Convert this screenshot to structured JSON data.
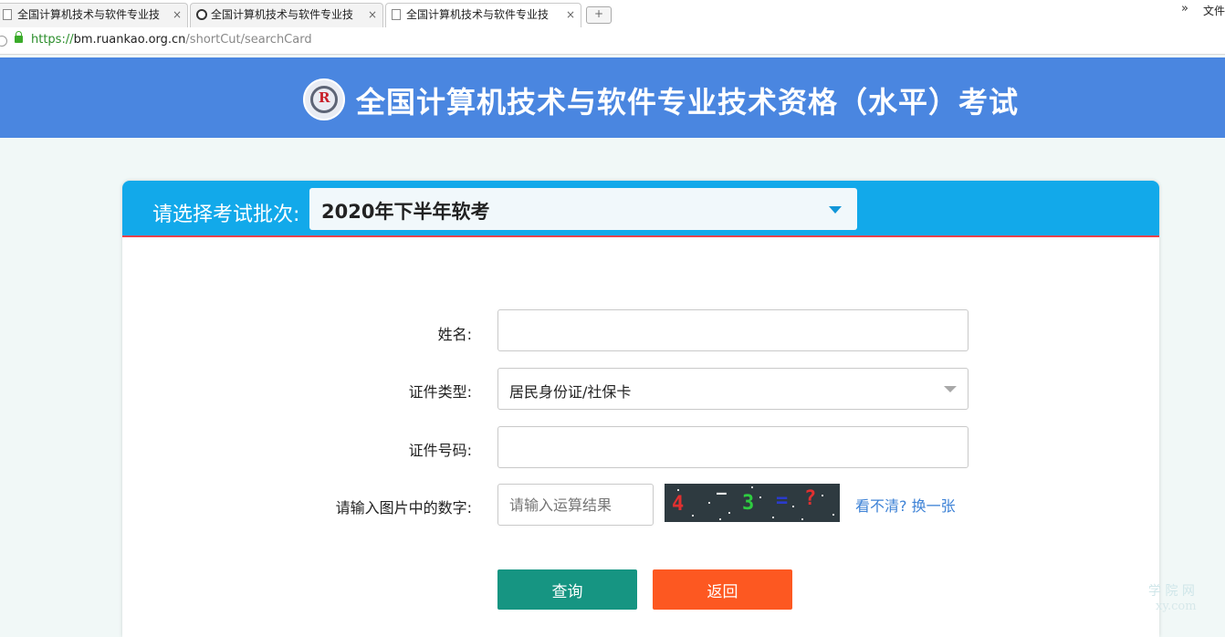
{
  "browser": {
    "tabs": [
      {
        "label": "全国计算机技术与软件专业技"
      },
      {
        "label": "全国计算机技术与软件专业技"
      },
      {
        "label": "全国计算机技术与软件专业技"
      }
    ],
    "close_glyph": "×",
    "new_tab_glyph": "+",
    "overflow_glyph": "»",
    "menu_label": "文件",
    "url": {
      "scheme": "https://",
      "host": "bm.ruankao.org.cn",
      "path": "/shortCut/searchCard"
    }
  },
  "header": {
    "title": "全国计算机技术与软件专业技术资格（水平）考试",
    "logo_icon": "ruankao-seal-logo"
  },
  "batch": {
    "label": "请选择考试批次:",
    "selected": "2020年下半年软考"
  },
  "form": {
    "name_label": "姓名:",
    "name_value": "",
    "id_type_label": "证件类型:",
    "id_type_selected": "居民身份证/社保卡",
    "id_number_label": "证件号码:",
    "id_number_value": "",
    "captcha_label": "请输入图片中的数字:",
    "captcha_placeholder": "请输入运算结果",
    "captcha_image_text": [
      "4",
      "—",
      "3",
      "=",
      "?"
    ],
    "refresh_link": "看不清? 换一张"
  },
  "buttons": {
    "query": "查询",
    "back": "返回"
  },
  "watermark": {
    "line1": "学 院 网",
    "line2": "xy.com"
  },
  "colors": {
    "banner": "#4a86e0",
    "card_header": "#12a9ea",
    "query_button": "#169582",
    "back_button": "#fd5821",
    "link": "#3d82d6"
  }
}
